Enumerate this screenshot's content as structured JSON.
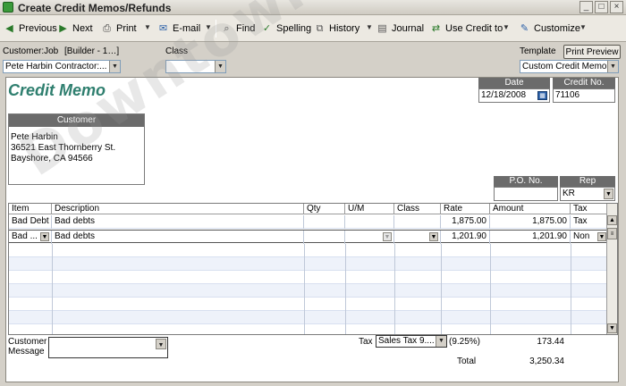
{
  "window": {
    "title": "Create Credit Memos/Refunds",
    "min": "_",
    "max": "□",
    "close": "×"
  },
  "toolbar": {
    "previous": "Previous",
    "next": "Next",
    "print": "Print",
    "email": "E-mail",
    "find": "Find",
    "spelling": "Spelling",
    "history": "History",
    "journal": "Journal",
    "use_credit_to": "Use Credit to",
    "customize": "Customize"
  },
  "header": {
    "customer_job_label": "Customer:Job",
    "customer_job_hint": "[Builder - 1…]",
    "customer_job_value": "Pete Harbin Contractor:...",
    "class_label": "Class",
    "class_value": "",
    "template_label": "Template",
    "print_preview": "Print Preview",
    "template_value": "Custom Credit Memo"
  },
  "form": {
    "title": "Credit Memo",
    "date_label": "Date",
    "date_value": "12/18/2008",
    "credit_no_label": "Credit No.",
    "credit_no_value": "71106",
    "customer_label": "Customer",
    "customer_address": "Pete Harbin\n36521 East Thornberry St.\nBayshore, CA 94566",
    "po_label": "P.O. No.",
    "po_value": "",
    "rep_label": "Rep",
    "rep_value": "KR"
  },
  "grid": {
    "columns": [
      "Item",
      "Description",
      "Qty",
      "U/M",
      "Class",
      "Rate",
      "Amount",
      "Tax"
    ],
    "rows": [
      {
        "item": "Bad Debt",
        "description": "Bad debts",
        "qty": "",
        "um": "",
        "class": "",
        "rate": "1,875.00",
        "amount": "1,875.00",
        "tax": "Tax"
      },
      {
        "item": "Bad ...",
        "description": "Bad debts",
        "qty": "",
        "um": "",
        "class": "",
        "rate": "1,201.90",
        "amount": "1,201.90",
        "tax": "Non"
      }
    ]
  },
  "footer": {
    "customer_message_label_1": "Customer",
    "customer_message_label_2": "Message",
    "customer_message_value": "",
    "tax_label": "Tax",
    "tax_item": "Sales Tax 9....",
    "tax_rate": "(9.25%)",
    "tax_amount": "173.44",
    "total_label": "Total",
    "total_amount": "3,250.34"
  },
  "watermark": "Downtown Bookkeeping"
}
